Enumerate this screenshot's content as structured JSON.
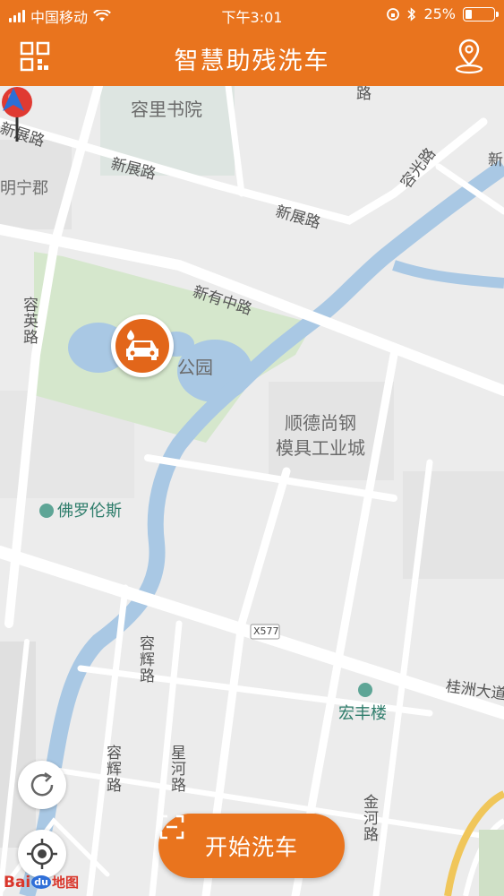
{
  "status_bar": {
    "carrier": "中国移动",
    "time": "下午3:01",
    "battery": "25%"
  },
  "header": {
    "title": "智慧助残洗车"
  },
  "map": {
    "labels": {
      "rongli_academy": "容里书院",
      "mingning_county": "明宁郡",
      "shunde_steel_mold": "顺德尚钢",
      "mold_industrial_city": "模具工业城",
      "park": "公园",
      "foluolunsi": "佛罗伦斯",
      "hongfeng_building": "宏丰楼",
      "x577": "X577"
    },
    "roads": {
      "xinzhan_1": "新展路",
      "xinzhan_2": "新展路",
      "xinzhan_3": "新展路",
      "rongguang": "容光路",
      "xinyouzhong": "新有中路",
      "rongying": "容英路",
      "ronghui_1": "容辉路",
      "ronghui_2": "容辉路",
      "xinghe": "星河路",
      "jinhe": "金河路",
      "guizhou": "桂洲大道",
      "top_road": "路",
      "right_xin": "新"
    }
  },
  "buttons": {
    "start_wash": "开始洗车"
  },
  "baidu_logo": {
    "part1": "Bai",
    "part2": "du",
    "part3": "地图"
  }
}
